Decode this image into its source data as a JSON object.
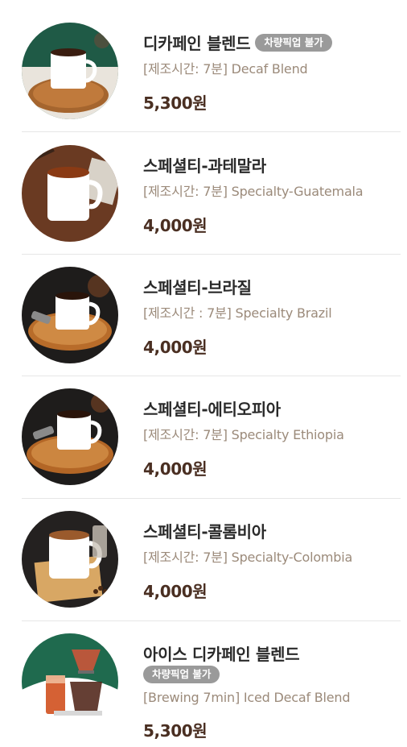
{
  "menu": {
    "items": [
      {
        "name": "디카페인 블렌드",
        "badge": "차량픽업 불가",
        "desc": "[제조시간: 7분] Decaf Blend",
        "price": "5,300원",
        "image": "decaf-blend-mug-photo"
      },
      {
        "name": "스페셜티-과테말라",
        "badge": "",
        "desc": "[제조시간: 7분] Specialty-Guatemala",
        "price": "4,000원",
        "image": "guatemala-mug-photo"
      },
      {
        "name": "스페셜티-브라질",
        "badge": "",
        "desc": "[제조시간 : 7분] Specialty Brazil",
        "price": "4,000원",
        "image": "brazil-mug-photo"
      },
      {
        "name": "스페셜티-에티오피아",
        "badge": "",
        "desc": "[제조시간: 7분] Specialty Ethiopia",
        "price": "4,000원",
        "image": "ethiopia-mug-photo"
      },
      {
        "name": "스페셜티-콜롬비아",
        "badge": "",
        "desc": "[제조시간: 7분] Specialty-Colombia",
        "price": "4,000원",
        "image": "colombia-mug-photo"
      },
      {
        "name": "아이스 디카페인 블렌드",
        "badge": "차량픽업 불가",
        "desc": "[Brewing 7min] Iced Decaf Blend",
        "price": "5,300원",
        "image": "iced-decaf-glass-photo"
      }
    ]
  },
  "colors": {
    "price": "#4a2f22",
    "desc": "#9b8a7a",
    "badge_bg": "#9a9a9a",
    "divider": "#e6e6e6"
  }
}
